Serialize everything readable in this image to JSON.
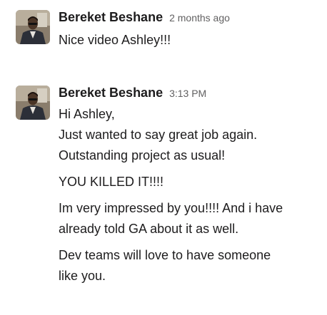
{
  "messages": [
    {
      "author": "Bereket Beshane",
      "timestamp": "2 months ago",
      "paragraphs": [
        [
          "Nice video Ashley!!!"
        ]
      ]
    },
    {
      "author": "Bereket Beshane",
      "timestamp": "3:13 PM",
      "paragraphs": [
        [
          "Hi Ashley,",
          "Just wanted to say great job again.",
          "Outstanding project as usual!"
        ],
        [
          "YOU KILLED IT!!!!"
        ],
        [
          "Im very impressed by you!!!! And i have",
          "already told GA about it as well."
        ],
        [
          "Dev teams will love to have someone",
          "like you."
        ]
      ]
    }
  ]
}
